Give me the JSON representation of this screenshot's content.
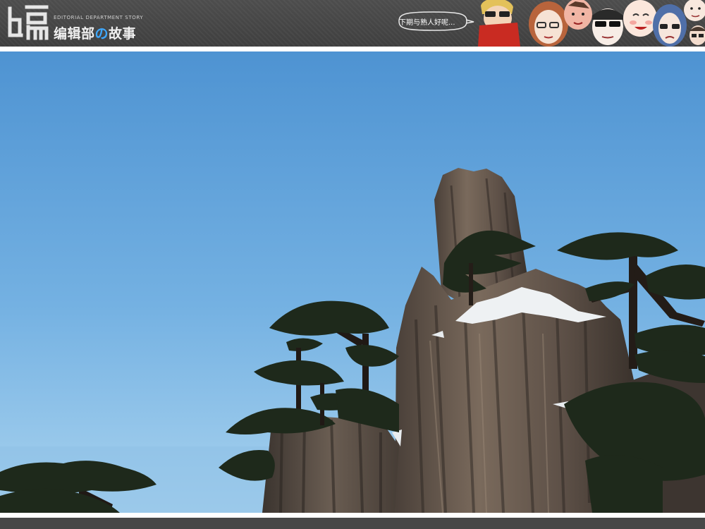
{
  "header": {
    "logo_glyph": "编",
    "logo_subtitle": "EDITORIAL DEPARTMENT STORY",
    "logo_title_before": "编辑部",
    "logo_title_accent": "の",
    "logo_title_after": "故事",
    "speech_bubble": "下期与熟人好呢...",
    "caricature_count": 8
  },
  "photo": {
    "subject": "granite-peak-with-pines",
    "colors": {
      "sky_top": "#4f94d3",
      "sky_bottom": "#8ec3ea",
      "rock": "#5d524a",
      "pine": "#1f2a1c"
    }
  }
}
